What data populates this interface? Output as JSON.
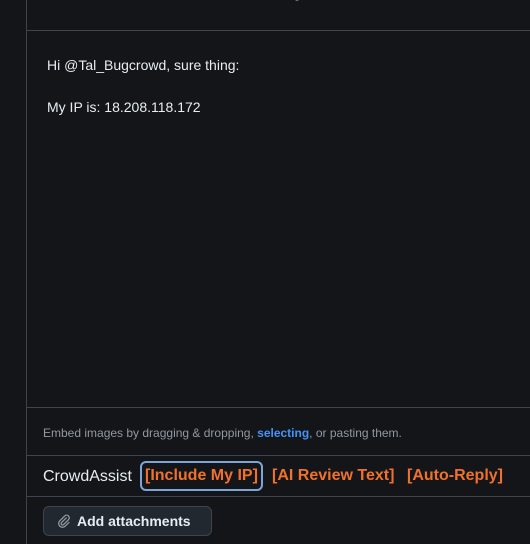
{
  "comment": {
    "line1": "Hi @Tal_Bugcrowd, sure thing:",
    "line2": "My IP is: 18.208.118.172"
  },
  "embed": {
    "prefix": "Embed images by dragging & dropping, ",
    "link": "selecting",
    "suffix": ", or pasting them."
  },
  "crowdassist": {
    "title": "CrowdAssist",
    "buttons": [
      "[Include My IP]",
      "[AI Review Text]",
      "[Auto-Reply]"
    ],
    "accent_color": "#f0712c",
    "focused_button": "[Include My IP]"
  },
  "attachments": {
    "label": "Add attachments",
    "icon": "paperclip-icon"
  }
}
